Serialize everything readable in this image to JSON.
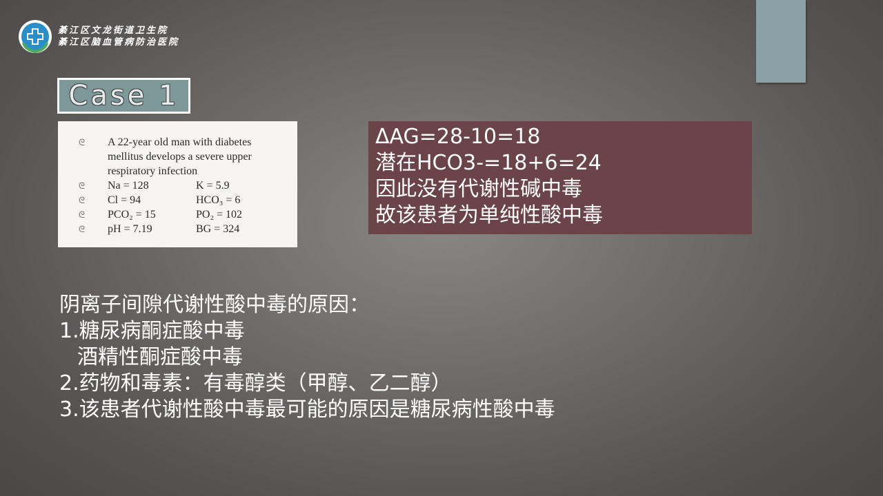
{
  "header": {
    "logo_line1": "綦江区文龙街道卫生院",
    "logo_line2": "綦江区脑血管病防治医院"
  },
  "case": {
    "title": "Case  1"
  },
  "case_image": {
    "intro": "A 22-year old man with diabetes mellitus develops a severe upper respiratory infection",
    "rows": [
      {
        "left": "Na = 128",
        "right": "K = 5.9"
      },
      {
        "left": "Cl = 94",
        "right": "HCO₃ = 6"
      },
      {
        "left": "PCO₂ = 15",
        "right": "PO₂ = 102"
      },
      {
        "left": "pH = 7.19",
        "right": "BG = 324"
      }
    ]
  },
  "calc": {
    "lines": [
      "ΔAG=28-10=18",
      "潜在HCO3-=18+6=24",
      "因此没有代谢性碱中毒",
      "故该患者为单纯性酸中毒"
    ]
  },
  "causes": {
    "heading": "阴离子间隙代谢性酸中毒的原因：",
    "item1": "1.糖尿病酮症酸中毒",
    "item1b": "酒精性酮症酸中毒",
    "item2": "2.药物和毒素：有毒醇类（甲醇、乙二醇）",
    "item3": "3.该患者代谢性酸中毒最可能的原因是糖尿病性酸中毒"
  }
}
